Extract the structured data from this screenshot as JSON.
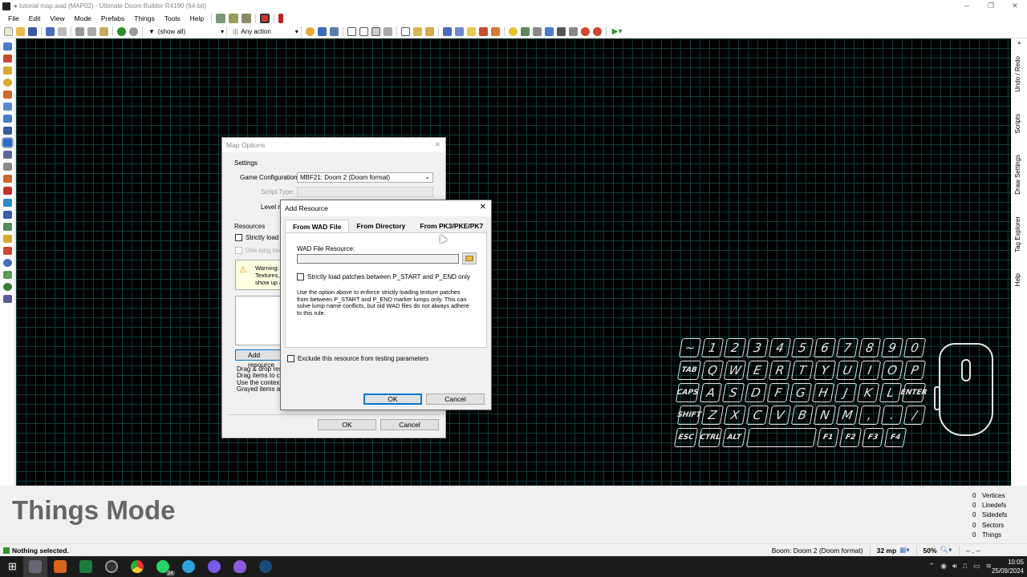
{
  "window": {
    "title": "● tutorial map.wad (MAP02) - Ultimate Doom Builder R4190 (64-bit)",
    "controls": [
      "─",
      "❐",
      "✕"
    ]
  },
  "menu": [
    "File",
    "Edit",
    "View",
    "Mode",
    "Prefabs",
    "Things",
    "Tools",
    "Help"
  ],
  "toolbar": {
    "filter_label": "(show all)",
    "action_label": "Any action"
  },
  "right_panels": [
    "Undo / Redo",
    "Scripts",
    "Draw Settings",
    "Tag Explorer",
    "Help"
  ],
  "mode_label": "Things Mode",
  "counts": [
    {
      "value": "0",
      "label": "Vertices"
    },
    {
      "value": "0",
      "label": "Linedefs"
    },
    {
      "value": "0",
      "label": "Sidedefs"
    },
    {
      "value": "0",
      "label": "Sectors"
    },
    {
      "value": "0",
      "label": "Things"
    }
  ],
  "status": {
    "message": "Nothing selected.",
    "game": "Boom: Doom 2 (Doom format)",
    "grid": "32 mp",
    "zoom": "50%",
    "coords": "-- , --"
  },
  "map_options": {
    "title": "Map Options",
    "settings_group": "Settings",
    "game_config_label": "Game Configuration:",
    "game_config_value": "MBF21: Doom 2 (Doom format)",
    "script_type_label": "Script Type:",
    "level_name_label": "Level na",
    "resources_group": "Resources",
    "strictly_load": "Strictly load pa",
    "use_long": "Use long text",
    "warning_text": "Warning: y Textures, f show up a",
    "add_resource_btn": "Add resource",
    "drag_text_1": "Drag & drop resou",
    "drag_text_2": "Drag items to cha",
    "drag_text_3": "Use the context m",
    "drag_text_4": "Grayed items are",
    "ok": "OK",
    "cancel": "Cancel"
  },
  "add_resource": {
    "title": "Add Resource",
    "tabs": [
      "From WAD File",
      "From Directory",
      "From PK3/PKE/PK7"
    ],
    "wad_label": "WAD File Resource:",
    "wad_value": "",
    "strict_label": "Strictly load patches between P_START and P_END only",
    "help_text": "Use the option above to enforce strictly loading texture patches from between P_START and P_END marker lumps only. This can solve lump name conflicts, but old WAD files do not always adhere to this rule.",
    "exclude_label": "Exclude this resource from testing parameters",
    "ok": "OK",
    "cancel": "Cancel"
  },
  "keyboard": {
    "row1": [
      "~",
      "1",
      "2",
      "3",
      "4",
      "5",
      "6",
      "7",
      "8",
      "9",
      "0"
    ],
    "row2": [
      "TAB",
      "Q",
      "W",
      "E",
      "R",
      "T",
      "Y",
      "U",
      "I",
      "O",
      "P"
    ],
    "row3": [
      "CAPS",
      "A",
      "S",
      "D",
      "F",
      "G",
      "H",
      "J",
      "K",
      "L",
      "ENTER"
    ],
    "row4": [
      "SHIFT",
      "Z",
      "X",
      "C",
      "V",
      "B",
      "N",
      "M",
      ",",
      ".",
      "/"
    ],
    "row5": [
      "ESC",
      "CTRL",
      "ALT",
      "",
      "F1",
      "F2",
      "F3",
      "F4"
    ]
  },
  "tray": {
    "time": "10:05",
    "date": "25/09/2024",
    "badge": "24"
  }
}
